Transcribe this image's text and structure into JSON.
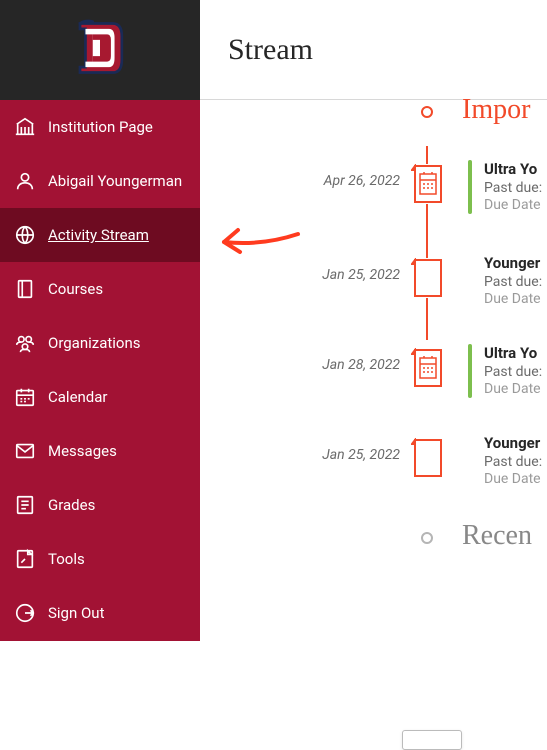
{
  "colors": {
    "accent_red": "#f24a2a",
    "sidebar_bg": "#a21234",
    "sidebar_selected": "#6e0b21",
    "green_bar": "#7dbf4e"
  },
  "header": {
    "title": "Stream"
  },
  "sidebar": {
    "items": [
      {
        "label": "Institution Page",
        "icon": "institution-icon"
      },
      {
        "label": "Abigail Youngerman",
        "icon": "person-icon"
      },
      {
        "label": "Activity Stream",
        "icon": "globe-icon",
        "selected": true
      },
      {
        "label": "Courses",
        "icon": "book-icon"
      },
      {
        "label": "Organizations",
        "icon": "people-icon"
      },
      {
        "label": "Calendar",
        "icon": "calendar-icon"
      },
      {
        "label": "Messages",
        "icon": "envelope-icon"
      },
      {
        "label": "Grades",
        "icon": "grades-icon"
      },
      {
        "label": "Tools",
        "icon": "tools-icon"
      },
      {
        "label": "Sign Out",
        "icon": "signout-icon"
      }
    ]
  },
  "sections": {
    "important": {
      "label": "Impor"
    },
    "recent": {
      "label": "Recen"
    }
  },
  "stream": [
    {
      "date": "Apr 26, 2022",
      "icon": "calendar",
      "green": true,
      "title": "Ultra Yo",
      "line2": "Past due:",
      "line3": "Due Date"
    },
    {
      "date": "Jan 25, 2022",
      "icon": "blank",
      "green": false,
      "title": "Younger",
      "line2": "Past due:",
      "line3": "Due Date"
    },
    {
      "date": "Jan 28, 2022",
      "icon": "calendar",
      "green": true,
      "title": "Ultra Yo",
      "line2": "Past due:",
      "line3": "Due Date"
    },
    {
      "date": "Jan 25, 2022",
      "icon": "blank",
      "green": false,
      "title": "Younger",
      "line2": "Past due:",
      "line3": "Due Date"
    }
  ]
}
